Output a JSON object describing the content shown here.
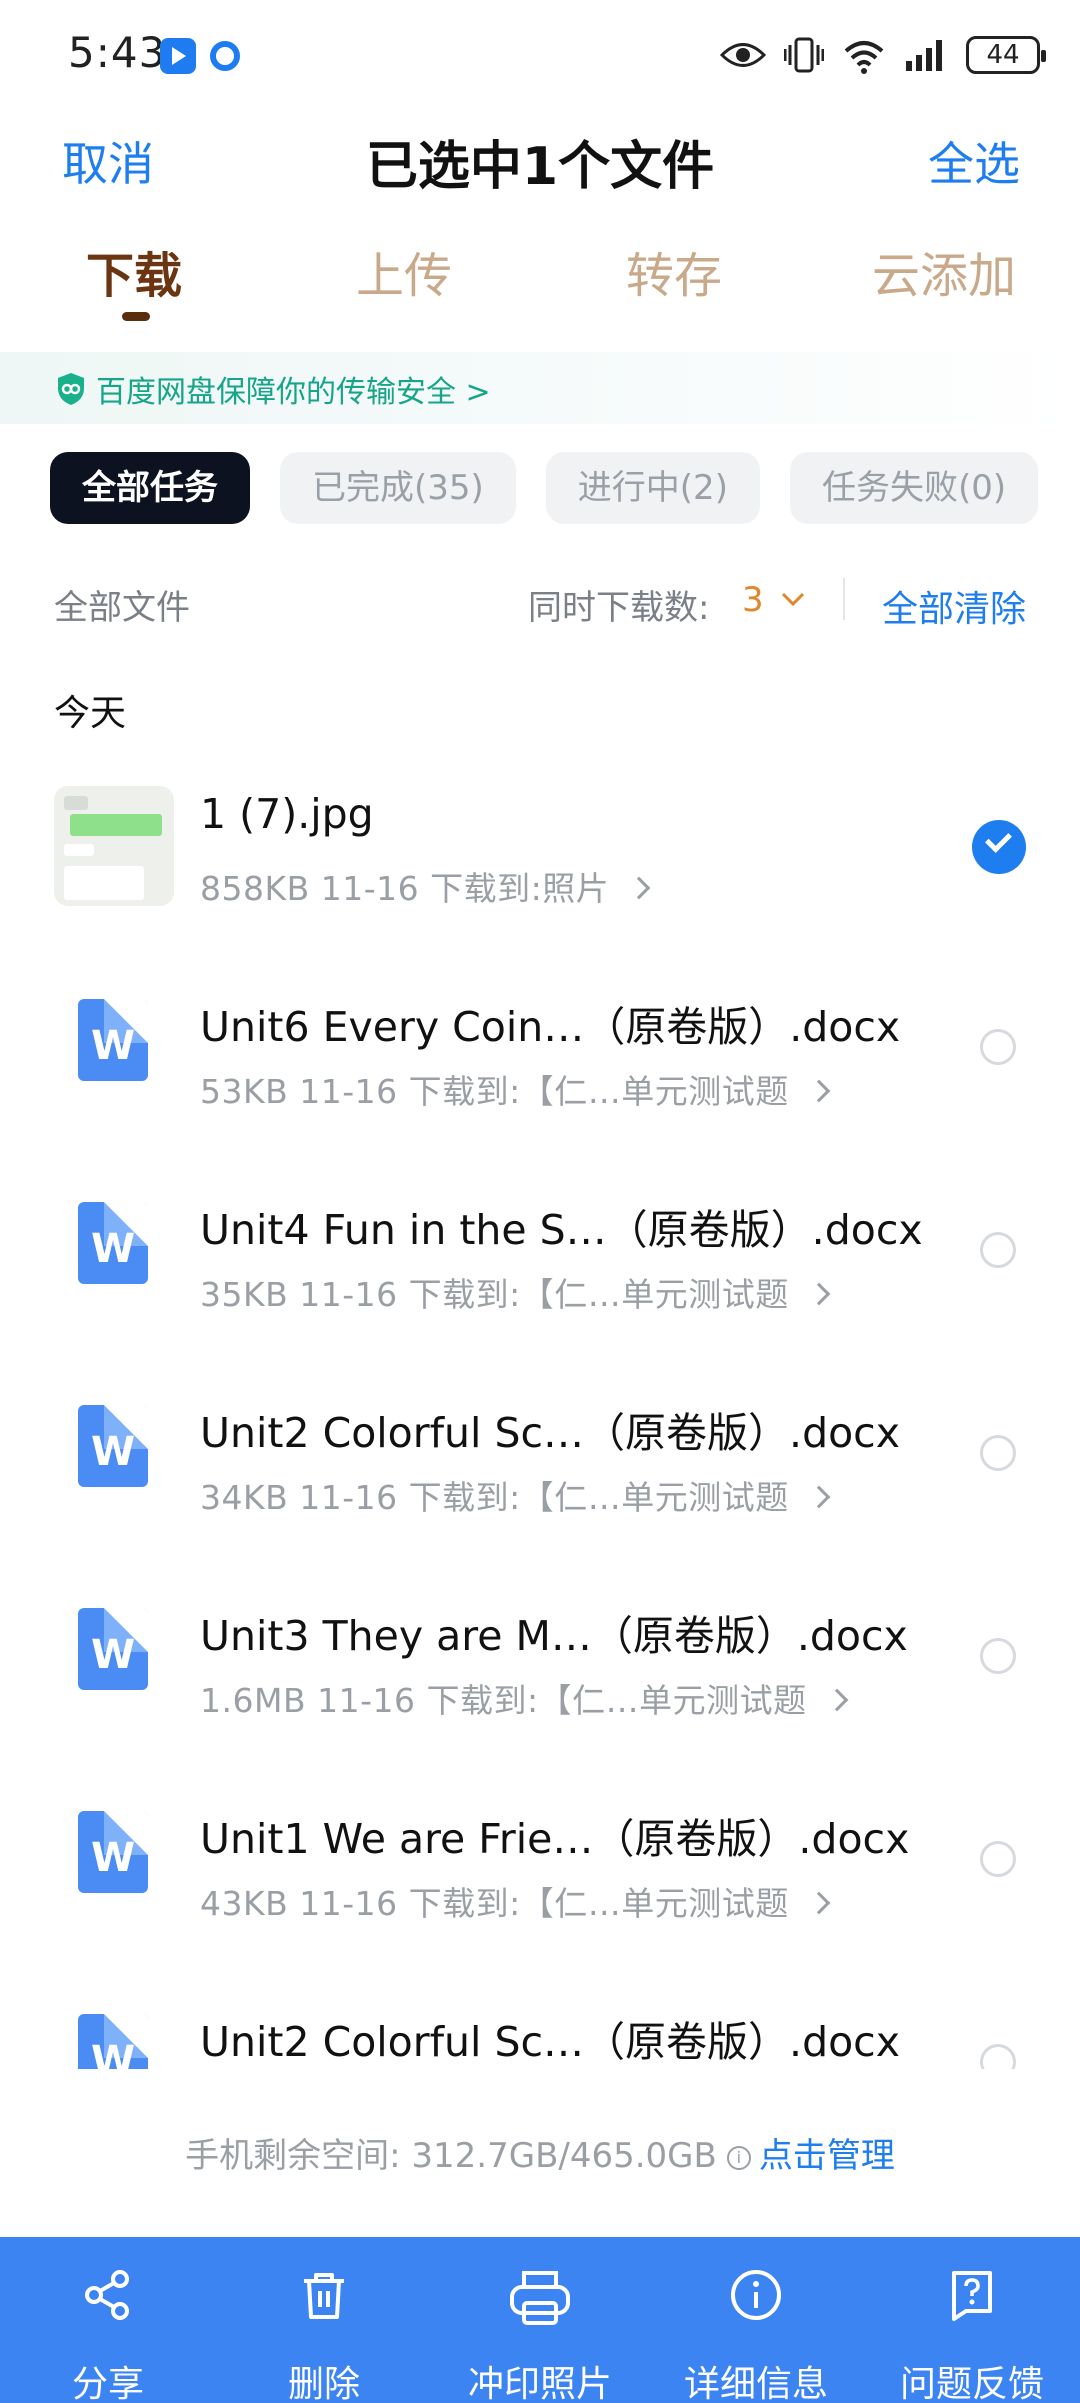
{
  "status_bar": {
    "time": "5:43",
    "battery": "44"
  },
  "header": {
    "cancel_label": "取消",
    "title": "已选中1个文件",
    "select_all_label": "全选"
  },
  "tabs": [
    {
      "label": "下载",
      "active": true
    },
    {
      "label": "上传",
      "active": false
    },
    {
      "label": "转存",
      "active": false
    },
    {
      "label": "云添加",
      "active": false
    }
  ],
  "banner": {
    "text": "百度网盘保障你的传输安全 >"
  },
  "filters": [
    {
      "label": "全部任务",
      "active": true
    },
    {
      "label": "已完成(35)",
      "active": false
    },
    {
      "label": "进行中(2)",
      "active": false
    },
    {
      "label": "任务失败(0)",
      "active": false
    }
  ],
  "toolbar": {
    "all_files_label": "全部文件",
    "concurrent_label": "同时下载数:",
    "concurrent_value": "3",
    "clear_all_label": "全部清除"
  },
  "section_date": "今天",
  "files": [
    {
      "name": "1 (7).jpg",
      "meta": "858KB  11-16  下载到:照片",
      "type": "image",
      "selected": true
    },
    {
      "name": "Unit6 Every Coin…（原卷版）.docx",
      "meta": "53KB  11-16  下载到:【仁…单元测试题",
      "type": "doc",
      "selected": false
    },
    {
      "name": "Unit4 Fun in the S…（原卷版）.docx",
      "meta": "35KB  11-16  下载到:【仁…单元测试题",
      "type": "doc",
      "selected": false
    },
    {
      "name": "Unit2 Colorful Sc…（原卷版）.docx",
      "meta": "34KB  11-16  下载到:【仁…单元测试题",
      "type": "doc",
      "selected": false
    },
    {
      "name": "Unit3 They are M…（原卷版）.docx",
      "meta": "1.6MB  11-16  下载到:【仁…单元测试题",
      "type": "doc",
      "selected": false
    },
    {
      "name": "Unit1 We are Frie…（原卷版）.docx",
      "meta": "43KB  11-16  下载到:【仁…单元测试题",
      "type": "doc",
      "selected": false
    },
    {
      "name": "Unit2 Colorful Sc…（原卷版）.docx",
      "meta": "",
      "type": "doc",
      "selected": false
    }
  ],
  "storage": {
    "label": "手机剩余空间: 312.7GB/465.0GB",
    "info_glyph": "i",
    "manage_label": "点击管理"
  },
  "actions": [
    {
      "label": "分享",
      "icon": "share-icon"
    },
    {
      "label": "删除",
      "icon": "trash-icon"
    },
    {
      "label": "冲印照片",
      "icon": "print-icon"
    },
    {
      "label": "详细信息",
      "icon": "info-icon"
    },
    {
      "label": "问题反馈",
      "icon": "feedback-icon"
    }
  ],
  "colors": {
    "accent": "#1e7ef0",
    "tab_active": "#6b3511",
    "tab_inactive": "#c9a98a",
    "banner_text": "#17a58a",
    "action_bar": "#3d84f3"
  }
}
